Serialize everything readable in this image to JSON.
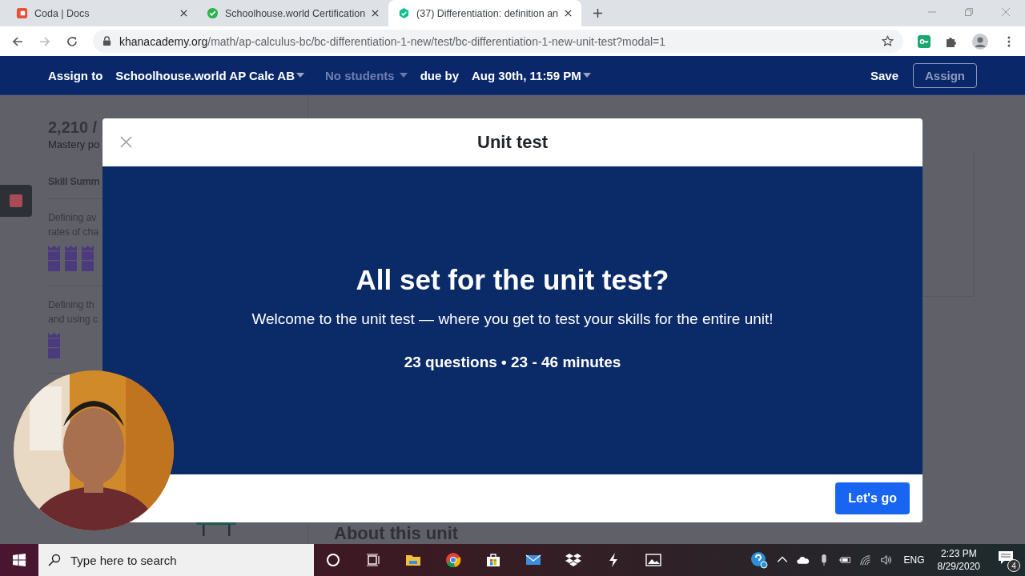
{
  "browser": {
    "tabs": [
      {
        "title": "Coda | Docs",
        "selected": false
      },
      {
        "title": "Schoolhouse.world Certification",
        "selected": false
      },
      {
        "title": "(37) Differentiation: definition an",
        "selected": true
      }
    ],
    "url": {
      "domain": "khanacademy.org",
      "path": "/math/ap-calculus-bc/bc-differentiation-1-new/test/bc-differentiation-1-new-unit-test?modal=1"
    }
  },
  "assign_bar": {
    "assign_label": "Assign to",
    "class_name": "Schoolhouse.world AP Calc AB",
    "students": "No students",
    "due_label": "due by",
    "due_date": "Aug 30th, 11:59 PM",
    "save": "Save",
    "assign": {
      "label": "Assign",
      "disabled": true
    }
  },
  "page": {
    "points": "2,210 /",
    "points_label": "Mastery po",
    "section_title": "Skill Summ",
    "skills": [
      {
        "lines": [
          "Defining av",
          "rates of cha"
        ],
        "badges": [
          {
            "kind": "mastered"
          },
          {
            "kind": "mastered"
          },
          {
            "kind": "mastered"
          }
        ]
      },
      {
        "lines": [
          "Defining th",
          "and using c"
        ],
        "badges": [
          {
            "kind": "mastered"
          }
        ]
      }
    ],
    "about_title": "About this unit"
  },
  "modal": {
    "title": "Unit test",
    "heading": "All set for the unit test?",
    "intro": "Welcome to the unit test — where you get to test your skills for the entire unit!",
    "summary": "23 questions • 23 - 46 minutes",
    "button": "Let's go"
  },
  "taskbar": {
    "search_placeholder": "Type here to search",
    "language": "ENG",
    "time": "2:23 PM",
    "date": "8/29/2020",
    "notifications": "4"
  }
}
